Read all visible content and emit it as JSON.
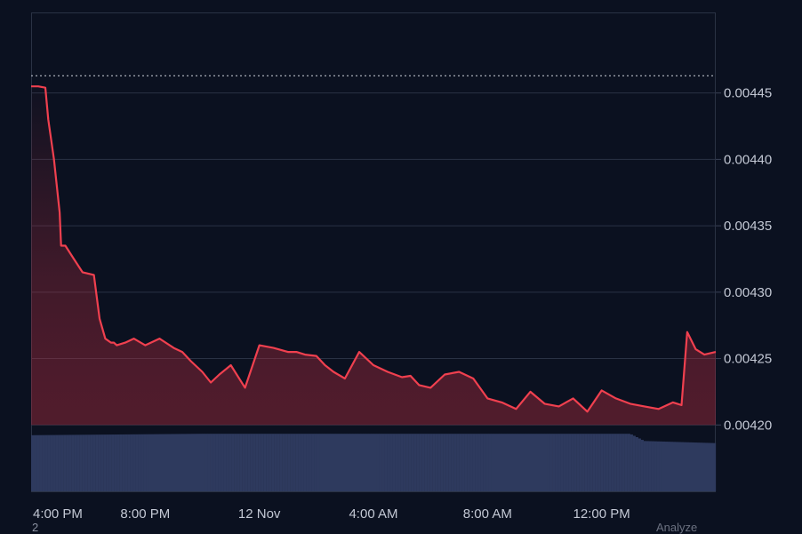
{
  "chart_data": {
    "type": "line",
    "line_color": "#f0404f",
    "volume_color": "#2e3a5e",
    "background": "#0b1120",
    "ylim": [
      0.00415,
      0.00451
    ],
    "yticks": [
      "0.00445",
      "0.00440",
      "0.00435",
      "0.00430",
      "0.00425",
      "0.00420"
    ],
    "ytick_values": [
      0.00445,
      0.0044,
      0.00435,
      0.0043,
      0.00425,
      0.0042
    ],
    "xticks": [
      "4:00 PM",
      "8:00 PM",
      "12 Nov",
      "4:00 AM",
      "8:00 AM",
      "12:00 PM"
    ],
    "xtick_hours": [
      0,
      4,
      8,
      12,
      16,
      20
    ],
    "x_range_hours": [
      0,
      24
    ],
    "reference_line": 0.004463,
    "series": [
      {
        "x_hours": [
          0,
          0.25,
          0.5,
          0.6,
          0.8,
          1.0,
          1.05,
          1.2,
          1.5,
          1.8,
          2.0,
          2.2,
          2.4,
          2.6,
          2.8,
          2.9,
          3.0,
          3.3,
          3.6,
          4.0,
          4.5,
          5.0,
          5.3,
          5.6,
          6.0,
          6.3,
          6.6,
          7.0,
          7.5,
          8.0,
          8.5,
          9.0,
          9.3,
          9.6,
          10.0,
          10.3,
          10.6,
          11.0,
          11.5,
          12.0,
          12.5,
          13.0,
          13.3,
          13.6,
          14.0,
          14.5,
          15.0,
          15.5,
          16.0,
          16.5,
          17.0,
          17.5,
          18.0,
          18.5,
          19.0,
          19.5,
          20.0,
          20.5,
          21.0,
          21.5,
          22.0,
          22.5,
          22.8,
          23.0,
          23.3,
          23.6,
          24.0
        ],
        "values": [
          0.004455,
          0.004455,
          0.004454,
          0.00443,
          0.0044,
          0.00436,
          0.004335,
          0.004335,
          0.004325,
          0.004315,
          0.004314,
          0.004313,
          0.00428,
          0.004265,
          0.004262,
          0.004262,
          0.00426,
          0.004262,
          0.004265,
          0.00426,
          0.004265,
          0.004258,
          0.004255,
          0.004248,
          0.00424,
          0.004232,
          0.004238,
          0.004245,
          0.004228,
          0.00426,
          0.004258,
          0.004255,
          0.004255,
          0.004253,
          0.004252,
          0.004245,
          0.00424,
          0.004235,
          0.004255,
          0.004245,
          0.00424,
          0.004236,
          0.004237,
          0.00423,
          0.004228,
          0.004238,
          0.00424,
          0.004235,
          0.00422,
          0.004217,
          0.004212,
          0.004225,
          0.004216,
          0.004214,
          0.00422,
          0.00421,
          0.004226,
          0.00422,
          0.004216,
          0.004214,
          0.004212,
          0.004217,
          0.004215,
          0.00427,
          0.004257,
          0.004253,
          0.004255
        ]
      }
    ],
    "volume": {
      "x_hours": [
        0,
        6,
        12,
        17,
        21,
        21.2,
        21.5,
        24
      ],
      "values": [
        0.78,
        0.8,
        0.8,
        0.8,
        0.8,
        0.76,
        0.7,
        0.67
      ]
    }
  },
  "footer": {
    "left": "2",
    "right": "Analyze"
  }
}
